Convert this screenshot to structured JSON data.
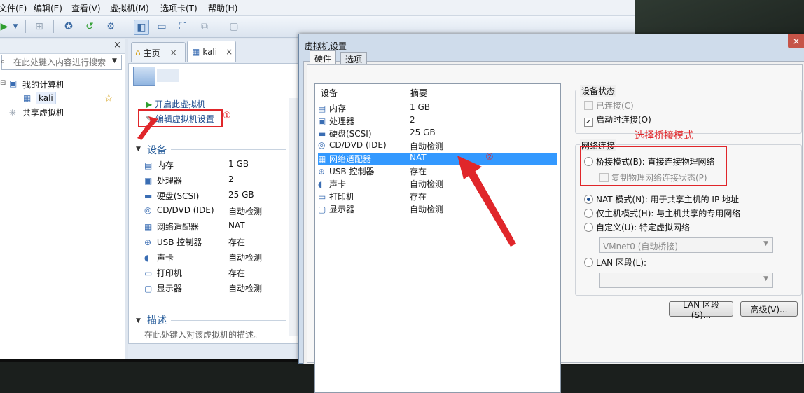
{
  "menu": [
    "文件(F)",
    "编辑(E)",
    "查看(V)",
    "虚拟机(M)",
    "选项卡(T)",
    "帮助(H)"
  ],
  "library": {
    "close": "×",
    "search_placeholder": "在此处键入内容进行搜索",
    "my_computer": "我的计算机",
    "vm_item": "kali",
    "shared": "共享虚拟机",
    "star": "☆"
  },
  "tabs": {
    "home": "主页",
    "kali": "kali",
    "close": "×"
  },
  "vm": {
    "power_on": "开启此虚拟机",
    "edit_settings": "编辑虚拟机设置",
    "devices_title": "设备",
    "devices": [
      {
        "name": "内存",
        "value": "1 GB",
        "icon": "▤"
      },
      {
        "name": "处理器",
        "value": "2",
        "icon": "▣"
      },
      {
        "name": "硬盘(SCSI)",
        "value": "25 GB",
        "icon": "▬"
      },
      {
        "name": "CD/DVD (IDE)",
        "value": "自动检测",
        "icon": "◎"
      },
      {
        "name": "网络适配器",
        "value": "NAT",
        "icon": "▦"
      },
      {
        "name": "USB 控制器",
        "value": "存在",
        "icon": "⊕"
      },
      {
        "name": "声卡",
        "value": "自动检测",
        "icon": "◖"
      },
      {
        "name": "打印机",
        "value": "存在",
        "icon": "▭"
      },
      {
        "name": "显示器",
        "value": "自动检测",
        "icon": "▢"
      }
    ],
    "desc_title": "描述",
    "desc_placeholder": "在此处键入对该虚拟机的描述。"
  },
  "dialog": {
    "title": "虚拟机设置",
    "close": "×",
    "tabs": [
      "硬件",
      "选项"
    ],
    "col_device": "设备",
    "col_summary": "摘要",
    "devices": [
      {
        "name": "内存",
        "value": "1 GB",
        "icon": "▤"
      },
      {
        "name": "处理器",
        "value": "2",
        "icon": "▣"
      },
      {
        "name": "硬盘(SCSI)",
        "value": "25 GB",
        "icon": "▬"
      },
      {
        "name": "CD/DVD (IDE)",
        "value": "自动检测",
        "icon": "◎"
      },
      {
        "name": "网络适配器",
        "value": "NAT",
        "icon": "▦"
      },
      {
        "name": "USB 控制器",
        "value": "存在",
        "icon": "⊕"
      },
      {
        "name": "声卡",
        "value": "自动检测",
        "icon": "◖"
      },
      {
        "name": "打印机",
        "value": "存在",
        "icon": "▭"
      },
      {
        "name": "显示器",
        "value": "自动检测",
        "icon": "▢"
      }
    ],
    "device_status_title": "设备状态",
    "connected": "已连接(C)",
    "connect_at_power_on": "启动时连接(O)",
    "network_title": "网络连接",
    "bridged": "桥接模式(B): 直接连接物理网络",
    "replicate": "复制物理网络连接状态(P)",
    "nat": "NAT 模式(N): 用于共享主机的 IP 地址",
    "host_only": "仅主机模式(H): 与主机共享的专用网络",
    "custom": "自定义(U): 特定虚拟网络",
    "custom_value": "VMnet0 (自动桥接)",
    "lan": "LAN 区段(L):",
    "lan_btn": "LAN 区段(S)...",
    "advanced_btn": "高级(V)...",
    "check": "✓"
  },
  "annotations": {
    "step1": "①",
    "step2": "②",
    "bridge_note": "选择桥接模式"
  },
  "colors": {
    "annotation": "#e0262a",
    "selection": "#3399ff"
  }
}
